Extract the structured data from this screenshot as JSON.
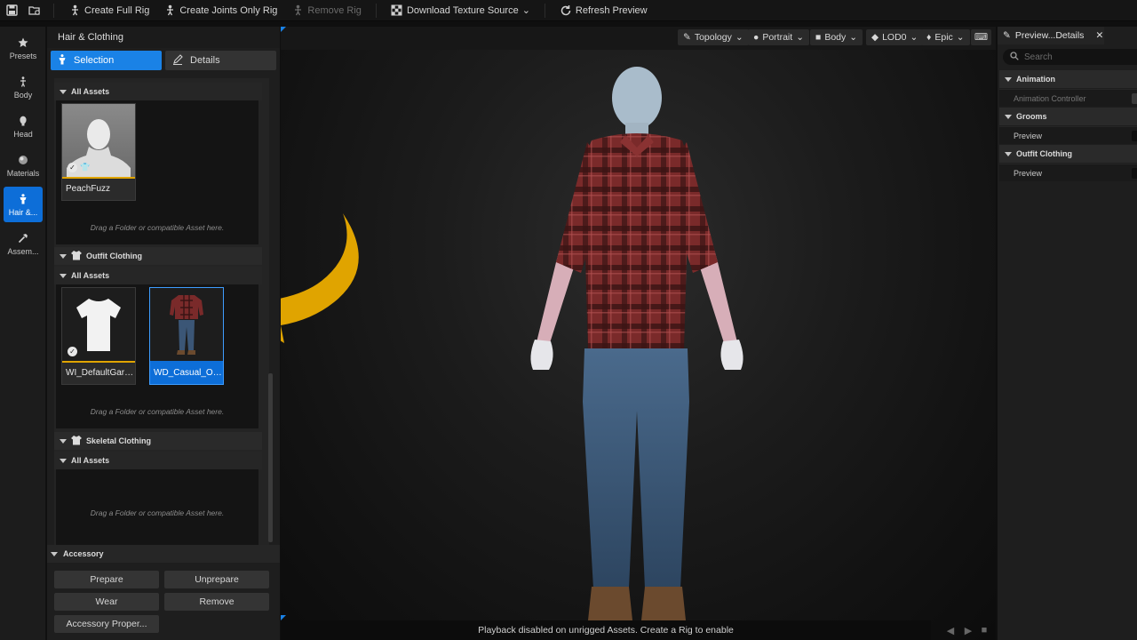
{
  "toolbar": {
    "create_full_rig": "Create Full Rig",
    "create_joints_only_rig": "Create Joints Only Rig",
    "remove_rig": "Remove Rig",
    "download_texture_source": "Download Texture Source",
    "refresh_preview": "Refresh Preview"
  },
  "nav": {
    "presets": "Presets",
    "body": "Body",
    "head": "Head",
    "materials": "Materials",
    "hair_clothing": "Hair &...",
    "assembly": "Assem..."
  },
  "panel": {
    "title": "Hair & Clothing",
    "tab_selection": "Selection",
    "tab_details": "Details",
    "all_assets": "All Assets",
    "drop_hint": "Drag a Folder or compatible Asset here.",
    "section_outfit": "Outfit Clothing",
    "section_skeletal": "Skeletal Clothing",
    "assets": {
      "peachfuzz": "PeachFuzz",
      "default_garment": "WI_DefaultGarment",
      "casual_outfit": "WD_Casual_Outfi..."
    }
  },
  "accessory": {
    "title": "Accessory",
    "prepare": "Prepare",
    "unprepare": "Unprepare",
    "wear": "Wear",
    "remove": "Remove",
    "properties": "Accessory Proper..."
  },
  "viewport": {
    "topology": "Topology",
    "portrait": "Portrait",
    "body": "Body",
    "lod": "LOD0",
    "quality": "Epic",
    "status": "Playback disabled on unrigged Assets. Create a Rig to enable"
  },
  "details": {
    "tab": "Preview...Details",
    "search_placeholder": "Search",
    "animation": "Animation",
    "animation_controller": "Animation Controller",
    "grooms": "Grooms",
    "grooms_preview": "Preview",
    "outfit_clothing": "Outfit Clothing",
    "outfit_preview": "Preview"
  },
  "colors": {
    "accent": "#1a82e6",
    "arrow": "#e0a400",
    "shirt": "#7a2a2a",
    "jeans": "#3b5676"
  }
}
